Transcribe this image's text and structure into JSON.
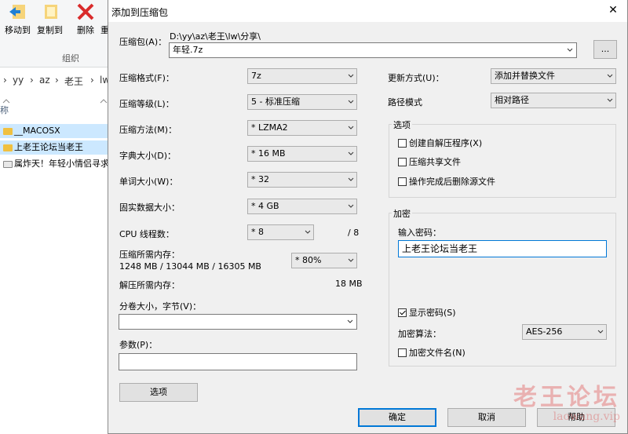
{
  "explorer": {
    "ribbon": {
      "move_to": "移动到",
      "copy_to": "复制到",
      "delete": "删除",
      "rename_partial": "重",
      "group_label": "组织"
    },
    "address": {
      "crumb_chevron": "›",
      "crumbs": [
        "yy",
        "az",
        "老王",
        "lw"
      ]
    },
    "column_name_partial": "称",
    "files": [
      "__MACOSX",
      "上老王论坛当老王",
      "属炸天！年轻小情侣寻求"
    ]
  },
  "dialog": {
    "title": "添加到压缩包",
    "close_icon_glyph": "✕",
    "archive_label": "压缩包(A)：",
    "archive_path": "D:\\yy\\az\\老王\\lw\\分享\\",
    "archive_name": "年轻.7z",
    "browse_label": "...",
    "format_label": "压缩格式(F)：",
    "format_value": "7z",
    "level_label": "压缩等级(L)：",
    "level_value": "5 - 标准压缩",
    "method_label": "压缩方法(M)：",
    "method_value": "* LZMA2",
    "dict_label": "字典大小(D)：",
    "dict_value": "* 16 MB",
    "word_label": "单词大小(W)：",
    "word_value": "* 32",
    "solid_label": "固实数据大小：",
    "solid_value": "* 4 GB",
    "threads_label": "CPU 线程数：",
    "threads_value": "* 8",
    "threads_max": "/ 8",
    "mem_compress_label": "压缩所需内存：",
    "mem_compress_value": "1248 MB / 13044 MB / 16305 MB",
    "mem_percent": "* 80%",
    "mem_decompress_label": "解压所需内存：",
    "mem_decompress_value": "18 MB",
    "volume_label": "分卷大小，字节(V)：",
    "volume_value": "",
    "params_label": "参数(P)：",
    "params_value": "",
    "options_button": "选项",
    "update_label": "更新方式(U)：",
    "update_value": "添加并替换文件",
    "path_label": "路径模式",
    "path_value": "相对路径",
    "options_group": {
      "title": "选项",
      "sfx": "创建自解压程序(X)",
      "shared": "压缩共享文件",
      "delete_after": "操作完成后删除源文件"
    },
    "encrypt_group": {
      "title": "加密",
      "password_label": "输入密码：",
      "password_value": "上老王论坛当老王",
      "show_password": "显示密码(S)",
      "method_label": "加密算法：",
      "method_value": "AES-256",
      "encrypt_names": "加密文件名(N)"
    },
    "ok_button": "确定",
    "cancel_button": "取消",
    "help_button": "帮助"
  },
  "watermark": {
    "main": "老王论坛",
    "sub": "laowang.vip"
  },
  "colors": {
    "accent": "#0078d7",
    "dialog_bg": "#f0f0f0",
    "selection": "#cce8ff"
  }
}
